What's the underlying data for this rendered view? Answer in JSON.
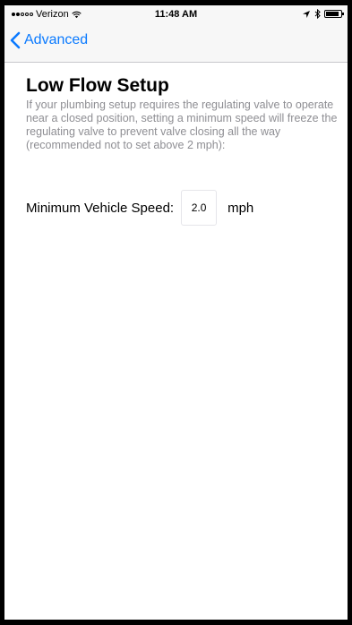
{
  "status_bar": {
    "carrier": "Verizon",
    "time": "11:48 AM",
    "battery_level": 0.85
  },
  "nav": {
    "back_label": "Advanced"
  },
  "page": {
    "title": "Low Flow Setup",
    "description": "If your plumbing setup requires the regulating valve to operate near a closed position, setting a minimum speed will freeze the regulating valve to prevent valve closing all the way (recommended not to set above 2 mph):"
  },
  "speed": {
    "label": "Minimum Vehicle Speed:",
    "value": "2.0",
    "unit": "mph"
  },
  "colors": {
    "accent": "#0a7aff",
    "description_text": "#8e8e93",
    "bar_background": "#f7f7f7"
  }
}
